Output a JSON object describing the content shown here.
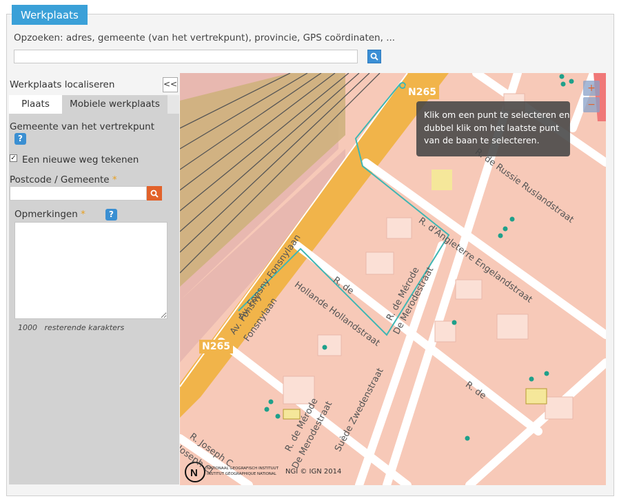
{
  "header": {
    "title": "Werkplaats"
  },
  "search": {
    "label": "Opzoeken: adres, gemeente (van het vertrekpunt), provincie, GPS coördinaten, ...",
    "value": "",
    "button_icon": "search-icon"
  },
  "panel": {
    "title": "Werkplaats localiseren",
    "collapse_label": "<<",
    "tabs": [
      {
        "label": "Plaats",
        "active": true
      },
      {
        "label": "Mobiele werkplaats",
        "active": false
      }
    ],
    "gemeente_label": "Gemeente van het vertrekpunt",
    "help_label": "?",
    "new_road_label": "Een nieuwe weg tekenen",
    "new_road_checked": true,
    "postcode_label": "Postcode / Gemeente",
    "required_mark": "*",
    "postcode_value": "",
    "notes_label": "Opmerkingen",
    "notes_value": "",
    "counter_value": "1000",
    "counter_text": "resterende karakters"
  },
  "map": {
    "tooltip": "Klik om een punt te selecteren en dubbel klik om het laatste punt van de baan te selecteren.",
    "zoom_in": "+",
    "zoom_out": "−",
    "road_badge": "N265",
    "streets": [
      "Av. Fonsny Fonsnylaan",
      "Av. Fonsny",
      "Fonsnylaan",
      "R. de Russie Ruslandstraat",
      "R. d'Angleterre Engelandstraat",
      "R. de",
      "Hollande Hollandstraat",
      "R. de Mérode",
      "De Merodestraat",
      "R. de Mérode",
      "De Merodestraat",
      "Suède Zwedenstraat",
      "R. de",
      "R. Joseph C",
      "Joseph Cl"
    ],
    "copyright": "NGI © IGN 2014",
    "ngi_line1": "NATIONAAL GEOGRAFISCH INSTITUUT",
    "ngi_line2": "INSTITUT GÉOGRAPHIQUE NATIONAL",
    "colors": {
      "background": "#f7c9b8",
      "road": "#ffffff",
      "main_road": "#f1b44a",
      "railway": "#cdb07a",
      "route": "#3fb6b3",
      "tree": "#1fa08a"
    }
  }
}
